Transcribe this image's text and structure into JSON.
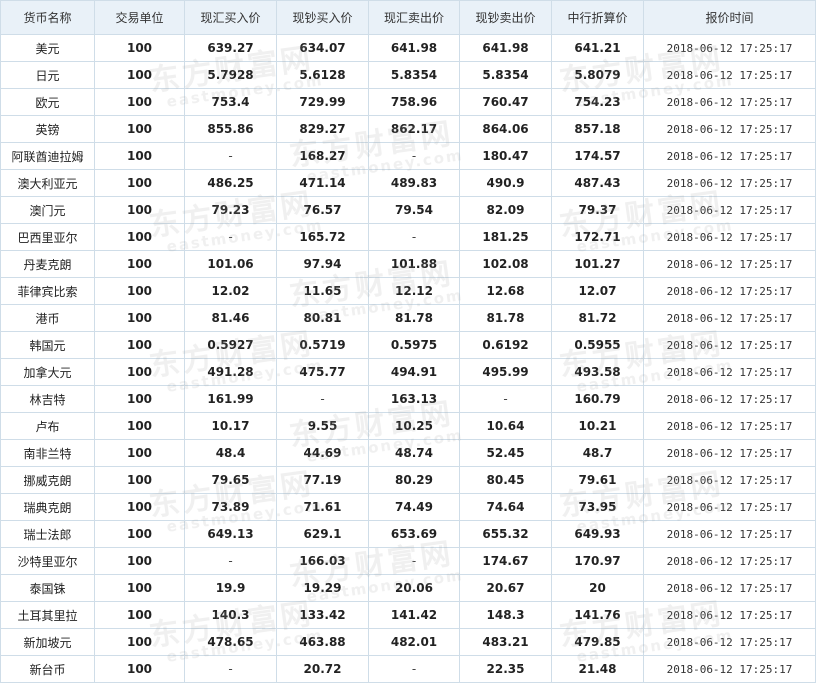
{
  "table": {
    "headers": [
      "货币名称",
      "交易单位",
      "现汇买入价",
      "现钞买入价",
      "现汇卖出价",
      "现钞卖出价",
      "中行折算价",
      "报价时间"
    ],
    "rows": [
      [
        "美元",
        "100",
        "639.27",
        "634.07",
        "641.98",
        "641.98",
        "641.21",
        "2018-06-12 17:25:17"
      ],
      [
        "日元",
        "100",
        "5.7928",
        "5.6128",
        "5.8354",
        "5.8354",
        "5.8079",
        "2018-06-12 17:25:17"
      ],
      [
        "欧元",
        "100",
        "753.4",
        "729.99",
        "758.96",
        "760.47",
        "754.23",
        "2018-06-12 17:25:17"
      ],
      [
        "英镑",
        "100",
        "855.86",
        "829.27",
        "862.17",
        "864.06",
        "857.18",
        "2018-06-12 17:25:17"
      ],
      [
        "阿联酋迪拉姆",
        "100",
        "-",
        "168.27",
        "-",
        "180.47",
        "174.57",
        "2018-06-12 17:25:17"
      ],
      [
        "澳大利亚元",
        "100",
        "486.25",
        "471.14",
        "489.83",
        "490.9",
        "487.43",
        "2018-06-12 17:25:17"
      ],
      [
        "澳门元",
        "100",
        "79.23",
        "76.57",
        "79.54",
        "82.09",
        "79.37",
        "2018-06-12 17:25:17"
      ],
      [
        "巴西里亚尔",
        "100",
        "-",
        "165.72",
        "-",
        "181.25",
        "172.71",
        "2018-06-12 17:25:17"
      ],
      [
        "丹麦克朗",
        "100",
        "101.06",
        "97.94",
        "101.88",
        "102.08",
        "101.27",
        "2018-06-12 17:25:17"
      ],
      [
        "菲律宾比索",
        "100",
        "12.02",
        "11.65",
        "12.12",
        "12.68",
        "12.07",
        "2018-06-12 17:25:17"
      ],
      [
        "港币",
        "100",
        "81.46",
        "80.81",
        "81.78",
        "81.78",
        "81.72",
        "2018-06-12 17:25:17"
      ],
      [
        "韩国元",
        "100",
        "0.5927",
        "0.5719",
        "0.5975",
        "0.6192",
        "0.5955",
        "2018-06-12 17:25:17"
      ],
      [
        "加拿大元",
        "100",
        "491.28",
        "475.77",
        "494.91",
        "495.99",
        "493.58",
        "2018-06-12 17:25:17"
      ],
      [
        "林吉特",
        "100",
        "161.99",
        "-",
        "163.13",
        "-",
        "160.79",
        "2018-06-12 17:25:17"
      ],
      [
        "卢布",
        "100",
        "10.17",
        "9.55",
        "10.25",
        "10.64",
        "10.21",
        "2018-06-12 17:25:17"
      ],
      [
        "南非兰特",
        "100",
        "48.4",
        "44.69",
        "48.74",
        "52.45",
        "48.7",
        "2018-06-12 17:25:17"
      ],
      [
        "挪威克朗",
        "100",
        "79.65",
        "77.19",
        "80.29",
        "80.45",
        "79.61",
        "2018-06-12 17:25:17"
      ],
      [
        "瑞典克朗",
        "100",
        "73.89",
        "71.61",
        "74.49",
        "74.64",
        "73.95",
        "2018-06-12 17:25:17"
      ],
      [
        "瑞士法郎",
        "100",
        "649.13",
        "629.1",
        "653.69",
        "655.32",
        "649.93",
        "2018-06-12 17:25:17"
      ],
      [
        "沙特里亚尔",
        "100",
        "-",
        "166.03",
        "-",
        "174.67",
        "170.97",
        "2018-06-12 17:25:17"
      ],
      [
        "泰国铢",
        "100",
        "19.9",
        "19.29",
        "20.06",
        "20.67",
        "20",
        "2018-06-12 17:25:17"
      ],
      [
        "土耳其里拉",
        "100",
        "140.3",
        "133.42",
        "141.42",
        "148.3",
        "141.76",
        "2018-06-12 17:25:17"
      ],
      [
        "新加坡元",
        "100",
        "478.65",
        "463.88",
        "482.01",
        "483.21",
        "479.85",
        "2018-06-12 17:25:17"
      ],
      [
        "新台币",
        "100",
        "-",
        "20.72",
        "-",
        "22.35",
        "21.48",
        "2018-06-12 17:25:17"
      ]
    ]
  },
  "watermark": {
    "cn": "东方财富网",
    "en": "eastmoney.com"
  }
}
